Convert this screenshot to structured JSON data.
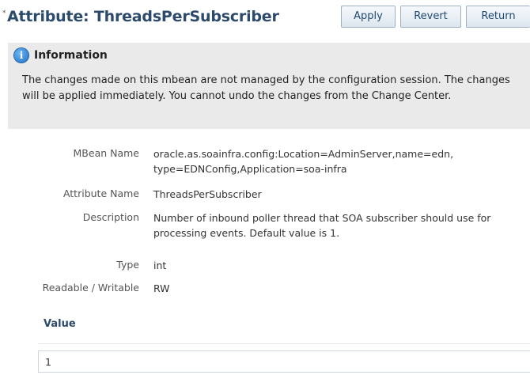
{
  "header": {
    "required_marker": "*",
    "title": "Attribute: ThreadsPerSubscriber",
    "buttons": {
      "apply": "Apply",
      "revert": "Revert",
      "return": "Return"
    }
  },
  "info": {
    "icon": "info-icon",
    "icon_glyph": "i",
    "title": "Information",
    "message": "The changes made on this mbean are not managed by the configuration session. The changes will be applied immediately. You cannot undo the changes from the Change Center."
  },
  "properties": [
    {
      "label": "MBean Name",
      "value": "oracle.as.soainfra.config:Location=AdminServer,name=edn, type=EDNConfig,Application=soa-infra"
    },
    {
      "label": "Attribute Name",
      "value": "ThreadsPerSubscriber"
    },
    {
      "label": "Description",
      "value": "Number of inbound poller thread that SOA subscriber should use for processing events. Default value is 1."
    },
    {
      "label": "Type",
      "value": "int"
    },
    {
      "label": "Readable / Writable",
      "value": "RW"
    }
  ],
  "value_section": {
    "title": "Value",
    "current_value": "1"
  },
  "colors": {
    "title": "#2c4a6c",
    "info_bg": "#eaeaea",
    "button_text": "#1f4a73"
  }
}
